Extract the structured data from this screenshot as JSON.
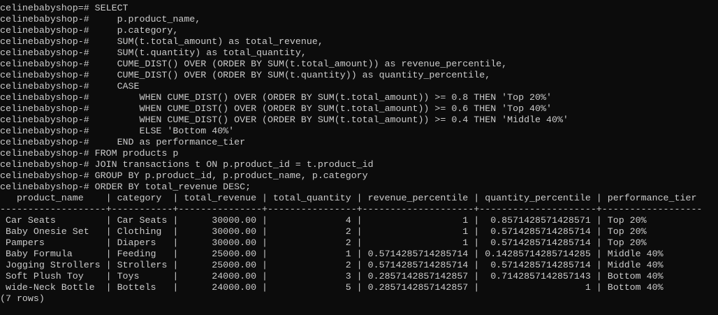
{
  "terminal": {
    "lines": [
      "celinebabyshop=# SELECT",
      "celinebabyshop-#     p.product_name,",
      "celinebabyshop-#     p.category,",
      "celinebabyshop-#     SUM(t.total_amount) as total_revenue,",
      "celinebabyshop-#     SUM(t.quantity) as total_quantity,",
      "celinebabyshop-#     CUME_DIST() OVER (ORDER BY SUM(t.total_amount)) as revenue_percentile,",
      "celinebabyshop-#     CUME_DIST() OVER (ORDER BY SUM(t.quantity)) as quantity_percentile,",
      "celinebabyshop-#     CASE",
      "celinebabyshop-#         WHEN CUME_DIST() OVER (ORDER BY SUM(t.total_amount)) >= 0.8 THEN 'Top 20%'",
      "celinebabyshop-#         WHEN CUME_DIST() OVER (ORDER BY SUM(t.total_amount)) >= 0.6 THEN 'Top 40%'",
      "celinebabyshop-#         WHEN CUME_DIST() OVER (ORDER BY SUM(t.total_amount)) >= 0.4 THEN 'Middle 40%'",
      "celinebabyshop-#         ELSE 'Bottom 40%'",
      "celinebabyshop-#     END as performance_tier",
      "celinebabyshop-# FROM products p",
      "celinebabyshop-# JOIN transactions t ON p.product_id = t.product_id",
      "celinebabyshop-# GROUP BY p.product_id, p.product_name, p.category",
      "celinebabyshop-# ORDER BY total_revenue DESC;",
      "   product_name    | category  | total_revenue | total_quantity | revenue_percentile | quantity_percentile | performance_tier",
      "-------------------+-----------+---------------+----------------+--------------------+---------------------+------------------",
      " Car Seats         | Car Seats |      30000.00 |              4 |                  1 |  0.8571428571428571 | Top 20%",
      " Baby Onesie Set   | Clothing  |      30000.00 |              2 |                  1 |  0.5714285714285714 | Top 20%",
      " Pampers           | Diapers   |      30000.00 |              2 |                  1 |  0.5714285714285714 | Top 20%",
      " Baby Formula      | Feeding   |      25000.00 |              1 | 0.5714285714285714 | 0.14285714285714285 | Middle 40%",
      " Jogging Strollers | Strollers |      25000.00 |              2 | 0.5714285714285714 |  0.5714285714285714 | Middle 40%",
      " Soft Plush Toy    | Toys      |      24000.00 |              3 | 0.2857142857142857 |  0.7142857142857143 | Bottom 40%",
      " wide-Neck Bottle  | Bottels   |      24000.00 |              5 | 0.2857142857142857 |                   1 | Bottom 40%",
      "(7 rows)",
      ""
    ]
  }
}
